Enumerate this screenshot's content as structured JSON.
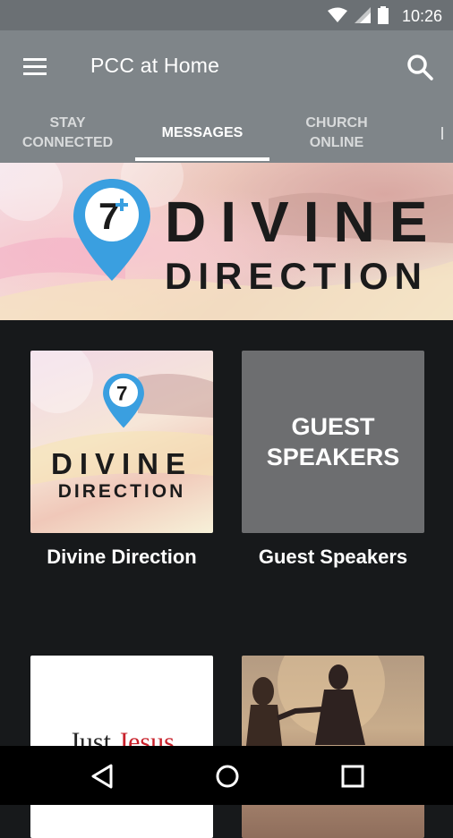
{
  "status_bar": {
    "time": "10:26"
  },
  "app_bar": {
    "title": "PCC at Home"
  },
  "tabs": [
    {
      "label": "Stay\nConnected"
    },
    {
      "label": "Messages"
    },
    {
      "label": "Church\nOnline"
    }
  ],
  "hero": {
    "number": "7",
    "line1": "DIVINE",
    "line2": "DIRECTION"
  },
  "cards": [
    {
      "caption": "Divine Direction",
      "thumb_line1": "DIVINE",
      "thumb_line2": "DIRECTION",
      "thumb_number": "7"
    },
    {
      "caption": "Guest Speakers",
      "thumb_line1": "GUEST",
      "thumb_line2": "SPEAKERS"
    },
    {
      "thumb_text_a": "Just ",
      "thumb_text_b": "Jesus"
    },
    {}
  ],
  "colors": {
    "pin_blue": "#3a9fe0",
    "app_bar": "#7f8589",
    "status_bar": "#6b7074",
    "background": "#17191b"
  }
}
